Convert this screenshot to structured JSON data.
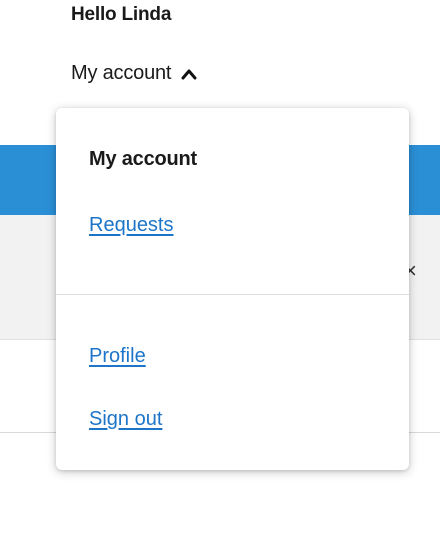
{
  "header": {
    "greeting": "Hello Linda",
    "account_menu_label": "My account",
    "chevron_icon": "chevron-up-icon"
  },
  "dropdown": {
    "heading": "My account",
    "links": {
      "requests": "Requests",
      "profile": "Profile",
      "sign_out": "Sign out"
    }
  },
  "background": {
    "close_glyph": "×",
    "colors": {
      "banner": "#2b8fd6",
      "panel": "#f2f2f2",
      "link": "#1c75c8"
    }
  }
}
